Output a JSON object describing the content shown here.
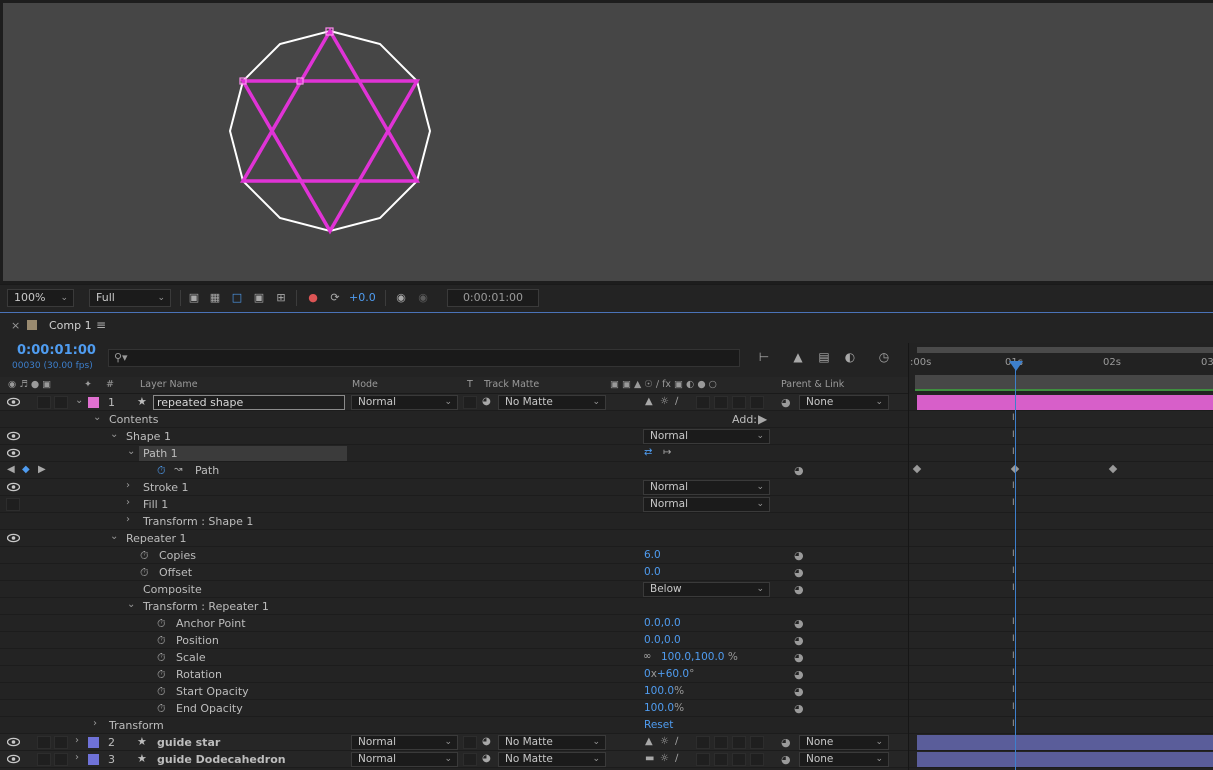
{
  "viewer": {
    "bg_color": "#464646",
    "shape_color": "#ffffff",
    "star_color": "#e033d6"
  },
  "viewer_toolbar": {
    "zoom": "100%",
    "resolution": "Full",
    "exposure": "+0.0",
    "timecode": "0:00:01:00"
  },
  "comp": {
    "tab_label": "Comp 1",
    "current_time": "0:00:01:00",
    "frames": "00030 (30.00 fps)"
  },
  "columns": {
    "layer_name": "Layer Name",
    "mode": "Mode",
    "t": "T",
    "track_matte": "Track Matte",
    "parent_link": "Parent & Link",
    "num": "#"
  },
  "layers": [
    {
      "index": "1",
      "name": "repeated shape",
      "mode": "Normal",
      "matte": "No Matte",
      "parent": "None",
      "color": "#e070d0"
    },
    {
      "index": "2",
      "name": "guide star",
      "mode": "Normal",
      "matte": "No Matte",
      "parent": "None",
      "color": "#6f72d8"
    },
    {
      "index": "3",
      "name": "guide Dodecahedron",
      "mode": "Normal",
      "matte": "No Matte",
      "parent": "None",
      "color": "#6f72d8"
    }
  ],
  "props": {
    "contents": "Contents",
    "add": "Add:",
    "shape1": "Shape 1",
    "shape1_mode": "Normal",
    "path1": "Path 1",
    "path": "Path",
    "stroke1": "Stroke 1",
    "stroke1_mode": "Normal",
    "fill1": "Fill 1",
    "fill1_mode": "Normal",
    "transform_shape1": "Transform : Shape 1",
    "repeater1": "Repeater 1",
    "copies": "Copies",
    "copies_val": "6.0",
    "offset": "Offset",
    "offset_val": "0.0",
    "composite": "Composite",
    "composite_val": "Below",
    "transform_repeater1": "Transform : Repeater 1",
    "anchor_point": "Anchor Point",
    "anchor_val": "0.0,0.0",
    "position": "Position",
    "position_val": "0.0,0.0",
    "scale": "Scale",
    "scale_val": "100.0,100.0",
    "scale_unit": "%",
    "rotation": "Rotation",
    "rotation_rev": "0",
    "rotation_x": "x",
    "rotation_deg": "+60.0",
    "rotation_unit": "°",
    "start_opacity": "Start Opacity",
    "start_opacity_val": "100.0",
    "end_opacity": "End Opacity",
    "end_opacity_val": "100.0",
    "pct": "%",
    "transform": "Transform",
    "reset": "Reset"
  },
  "timeline": {
    "ticks": [
      ":00s",
      "01s",
      "02s",
      "03"
    ],
    "accent": "#3d7fcc",
    "layer1_bar": "#d75fc9",
    "guide_bar": "#5a5d9a"
  }
}
